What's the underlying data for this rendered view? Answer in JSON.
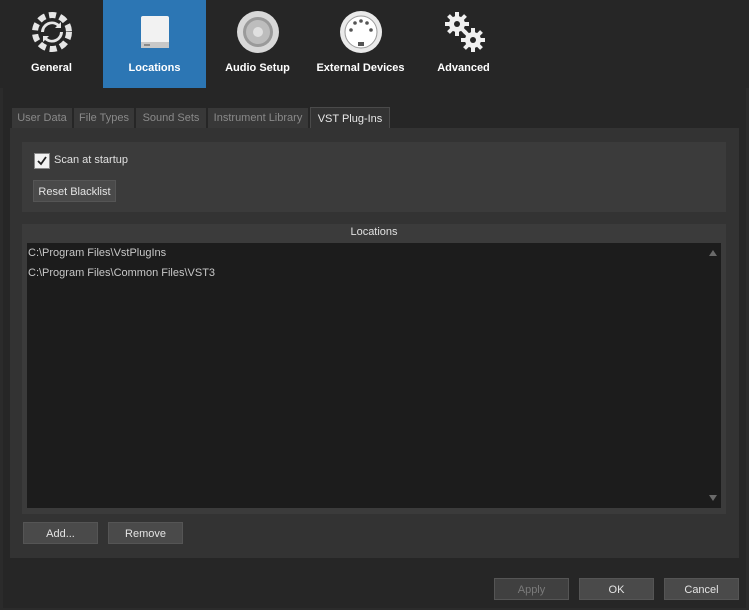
{
  "toolbar": {
    "items": [
      {
        "label": "General",
        "icon": "sync-gear-icon"
      },
      {
        "label": "Locations",
        "icon": "drive-icon"
      },
      {
        "label": "Audio Setup",
        "icon": "speaker-icon"
      },
      {
        "label": "External Devices",
        "icon": "midi-connector-icon"
      },
      {
        "label": "Advanced",
        "icon": "gears-icon"
      }
    ],
    "active": "Locations"
  },
  "tabs": [
    "User Data",
    "File Types",
    "Sound Sets",
    "Instrument Library",
    "VST Plug-Ins"
  ],
  "active_tab": "VST Plug-Ins",
  "scan": {
    "label": "Scan at startup",
    "checked": true,
    "reset_button": "Reset Blacklist"
  },
  "locations": {
    "header": "Locations",
    "items": [
      "C:\\Program Files\\VstPlugIns",
      "C:\\Program Files\\Common Files\\VST3"
    ],
    "add_button": "Add...",
    "remove_button": "Remove"
  },
  "footer": {
    "apply": "Apply",
    "ok": "OK",
    "cancel": "Cancel"
  },
  "colors": {
    "accent": "#2c76b4",
    "background": "#262626"
  }
}
